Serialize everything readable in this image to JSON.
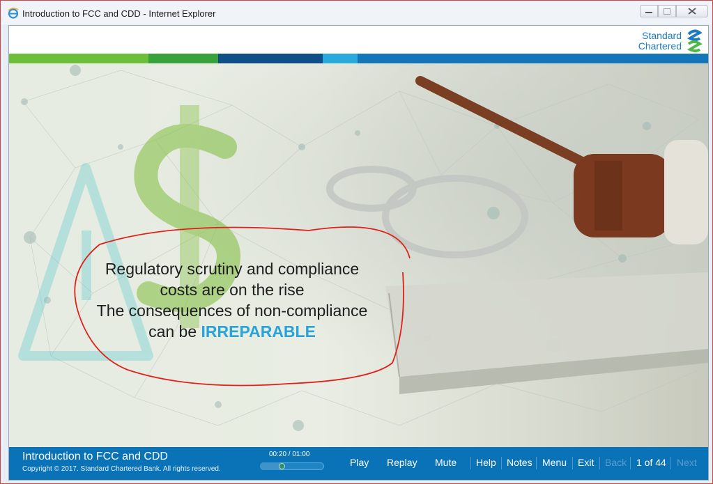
{
  "window": {
    "title": "Introduction to FCC and CDD - Internet Explorer"
  },
  "header": {
    "logo_line1": "Standard",
    "logo_line2": "Chartered"
  },
  "slide": {
    "line1": "Regulatory scrutiny and compliance",
    "line2": "costs are on the rise",
    "line3": "The consequences of non-compliance",
    "line4_prefix": "can be ",
    "line4_emphasis": "IRREPARABLE"
  },
  "footer": {
    "course_title": "Introduction to FCC and CDD",
    "copyright": "Copyright © 2017. Standard Chartered Bank. All rights reserved.",
    "time": "00:20 / 01:00",
    "progress": 0.333,
    "controls": {
      "play": "Play",
      "replay": "Replay",
      "mute": "Mute",
      "help": "Help",
      "notes": "Notes",
      "menu": "Menu",
      "exit": "Exit",
      "back": "Back",
      "page": "1 of 44",
      "next": "Next"
    }
  },
  "colors": {
    "brand_blue": "#0a73b7",
    "brand_green": "#6bbf3a",
    "emphasis": "#2aa3d8",
    "annotation": "#e0201b"
  },
  "icons": [
    "internet-explorer-icon",
    "minimize-icon",
    "maximize-icon",
    "close-icon",
    "standard-chartered-logo",
    "dollar-sign-icon",
    "warning-icon"
  ]
}
